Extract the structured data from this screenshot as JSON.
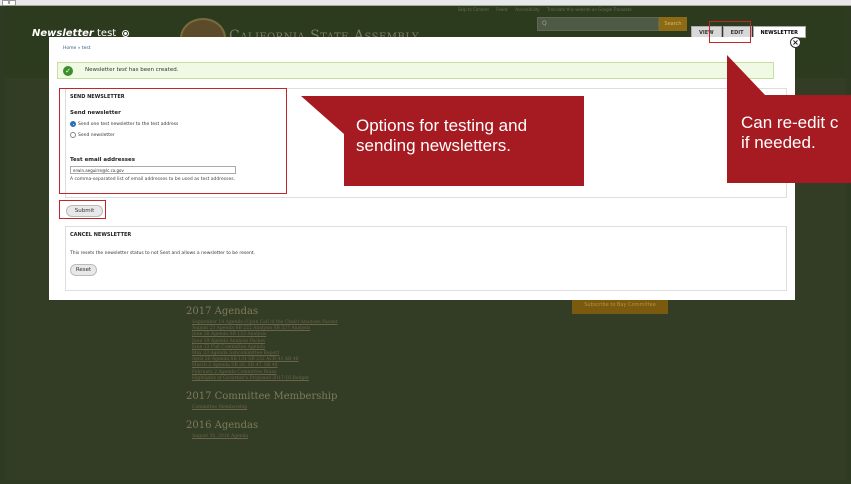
{
  "browser": {
    "tab_label": "x"
  },
  "site": {
    "skip_links": [
      "Skip to Content",
      "Feeds",
      "Accessibility",
      "Translate this website on Google Translate"
    ],
    "name": "California State Assembly",
    "search_placeholder": "Q",
    "search_button": "Search",
    "page_title_italic": "Newsletter",
    "page_title_rest": " test",
    "tabs": [
      "VIEW",
      "EDIT",
      "NEWSLETTER"
    ],
    "side_banner": "Subscribe to Bay Committee",
    "sections": [
      {
        "heading": "2017 Agendas",
        "items": [
          "September 14 Agenda (Upon Call of the Chair)   Analyses Packet",
          "August 23 Agenda   SB 222 Analysis   SB 327 Analysis",
          "June 28 Agenda   SB 123 Analysis",
          "June 19 Agenda   Analysis Packet",
          "June 13 Full Committee Agenda",
          "May 23 Agenda   Subcommittee Report",
          "April 26 Agenda   SB 131   SB 232   ACR 41   AB 46",
          "March 2 Agenda   SB 26, SB 47, SB 48",
          "February 2 Agenda   Committee Rules",
          "Highlights of Governor's Proposed 2017-18 Budget"
        ]
      },
      {
        "heading": "2017 Committee Membership",
        "items": [
          "Committee Membership"
        ]
      },
      {
        "heading": "2016 Agendas",
        "items": [
          "August 30, 2016   Agenda"
        ]
      }
    ]
  },
  "modal": {
    "breadcrumb": "Home » test",
    "close_icon": "close-icon",
    "status_prefix": "Newsletter ",
    "status_name": "test",
    "status_suffix": " has been created.",
    "send": {
      "legend": "SEND NEWSLETTER",
      "subtitle": "Send newsletter",
      "options": [
        {
          "label": "Send one test newsletter to the test address",
          "selected": true
        },
        {
          "label": "Send newsletter",
          "selected": false
        }
      ],
      "email_label": "Test email addresses",
      "email_value": "erwin.aeguirre@lc.ca.gov",
      "email_help": "A comma-separated list of email addresses to be used as test addresses."
    },
    "submit_label": "Submit",
    "cancel": {
      "legend": "CANCEL NEWSLETTER",
      "description": "This resets the newsletter status to not Sent and allows a newsletter to be resent.",
      "reset_label": "Reset"
    }
  },
  "annotations": {
    "options_callout": "Options for testing and sending newsletters.",
    "options_line1": "Options for testing and",
    "options_line2": "sending newsletters.",
    "edit_callout_line1": "Can re-edit c",
    "edit_callout_line2": "if needed.",
    "color": "#a61b22"
  }
}
